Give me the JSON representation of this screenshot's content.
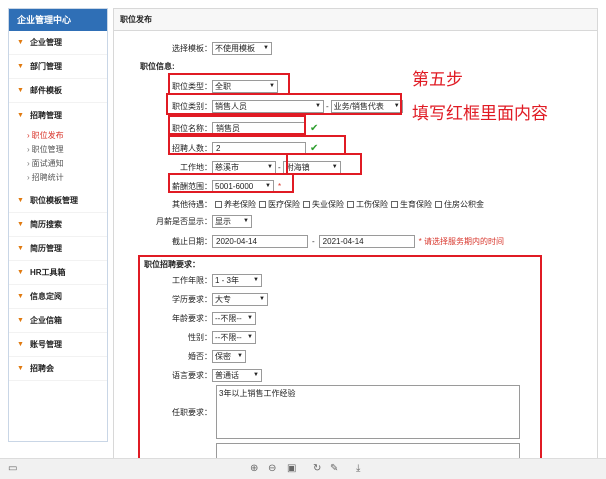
{
  "sidebar": {
    "title": "企业管理中心",
    "items": [
      {
        "label": "企业管理"
      },
      {
        "label": "部门管理"
      },
      {
        "label": "邮件模板"
      },
      {
        "label": "招聘管理"
      },
      {
        "label": "职位模板管理"
      },
      {
        "label": "简历搜索"
      },
      {
        "label": "简历管理"
      },
      {
        "label": "HR工具箱"
      },
      {
        "label": "信息定阅"
      },
      {
        "label": "企业信箱"
      },
      {
        "label": "账号管理"
      },
      {
        "label": "招聘会"
      }
    ],
    "sub_items": [
      {
        "label": "职位发布",
        "active": true
      },
      {
        "label": "职位管理",
        "active": false
      },
      {
        "label": "面试通知",
        "active": false
      },
      {
        "label": "招聘统计",
        "active": false
      }
    ]
  },
  "main": {
    "header": "职位发布",
    "template": {
      "label": "选择模板：",
      "value": "不使用模板"
    },
    "section_info": "职位信息:",
    "job_type": {
      "label": "职位类型：",
      "value": "全职"
    },
    "job_category": {
      "label": "职位类别：",
      "value": "销售人员",
      "sub_value": "业务/销售代表"
    },
    "job_name": {
      "label": "职位名称：",
      "value": "销售员"
    },
    "headcount": {
      "label": "招聘人数：",
      "value": "2"
    },
    "location": {
      "label": "工作地：",
      "city": "慈溪市",
      "town": "附海镇"
    },
    "salary": {
      "label": "薪酬范围：",
      "value": "5001-6000",
      "required": "*"
    },
    "benefits": {
      "label": "其他待遇：",
      "options": [
        "养老保险",
        "医疗保险",
        "失业保险",
        "工伤保险",
        "生育保险",
        "住房公积金"
      ]
    },
    "show_salary": {
      "label": "月薪是否显示：",
      "value": "显示"
    },
    "deadline": {
      "label": "截止日期：",
      "start": "2020-04-14",
      "separator": "-",
      "end": "2021-04-14",
      "note": "* 请选择服务期内的时间"
    },
    "section_req": "职位招聘要求：",
    "experience": {
      "label": "工作年限：",
      "value": "1 - 3年"
    },
    "education": {
      "label": "学历要求：",
      "value": "大专"
    },
    "age": {
      "label": "年龄要求：",
      "value": "--不限--"
    },
    "gender": {
      "label": "性别：",
      "value": "--不限--"
    },
    "marital": {
      "label": "婚否：",
      "value": "保密"
    },
    "language": {
      "label": "语言要求：",
      "value": "普通话"
    },
    "duties": {
      "label": "任职要求：",
      "value": "3年以上销售工作经验"
    }
  },
  "annotation": {
    "line1": "第五步",
    "line2": "填写红框里面内容"
  },
  "colors": {
    "accent": "#2f6fb6",
    "highlight": "#e01b24",
    "check": "#2e9e2e"
  },
  "toolbar_icons": [
    "sidebar-toggle-icon",
    "zoom-in-icon",
    "zoom-out-icon",
    "fit-page-icon",
    "rotate-icon",
    "edit-icon",
    "download-icon"
  ]
}
